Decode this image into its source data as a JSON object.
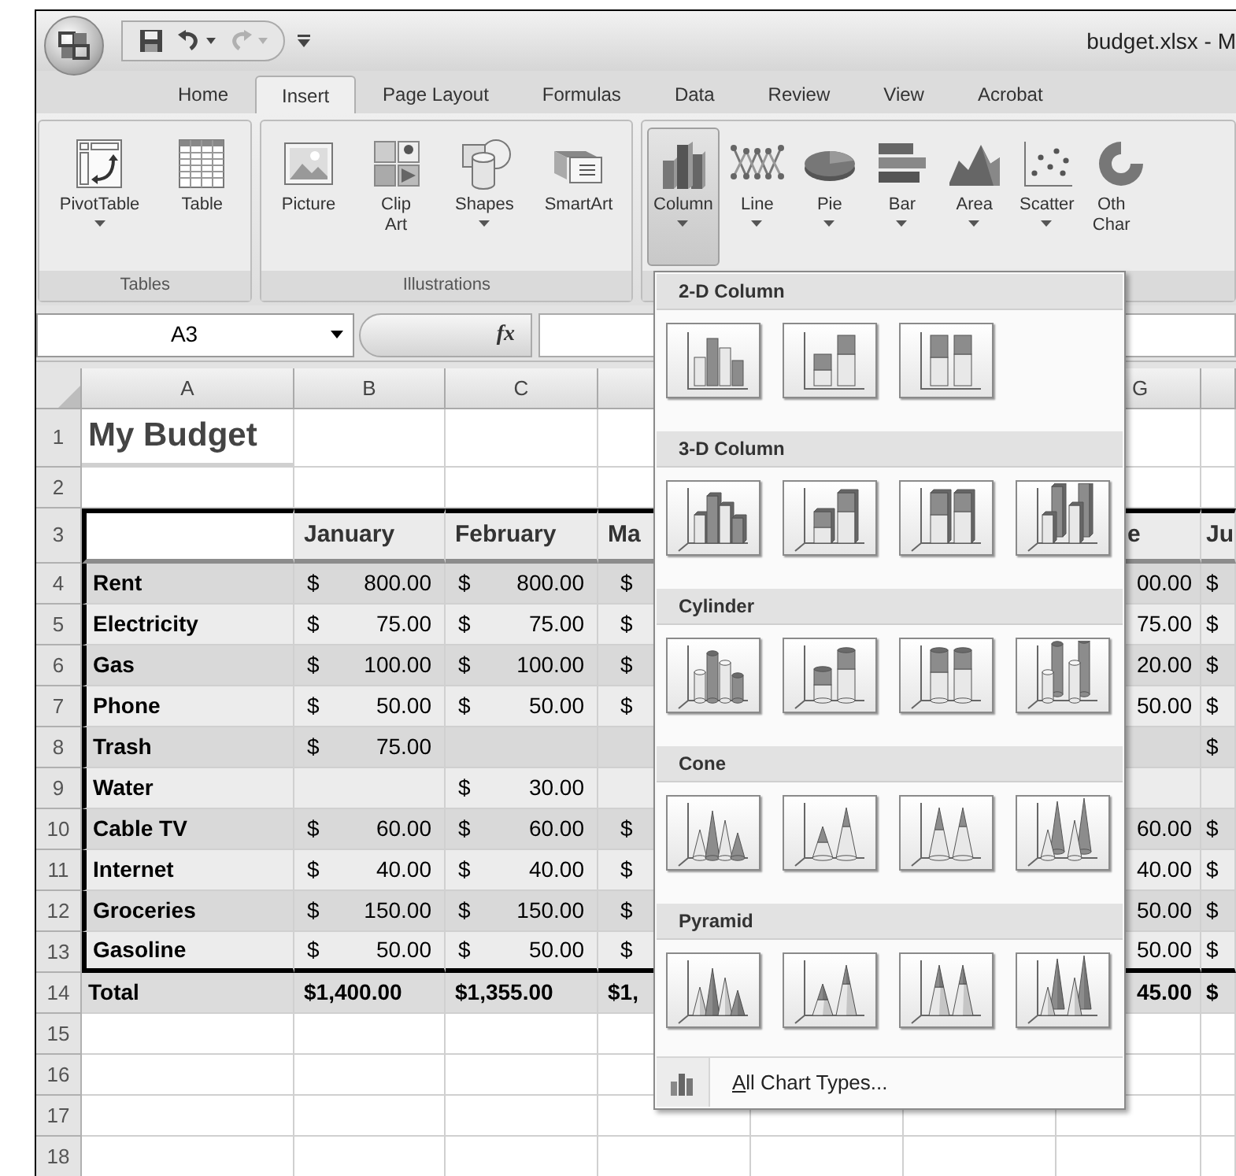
{
  "window": {
    "title": "budget.xlsx - M"
  },
  "quick_access": [
    {
      "kind": "save",
      "disabled": false
    },
    {
      "kind": "undo",
      "disabled": false
    },
    {
      "kind": "redo",
      "disabled": true
    }
  ],
  "ribbon_tabs": [
    {
      "label": "Home",
      "selected": false
    },
    {
      "label": "Insert",
      "selected": true
    },
    {
      "label": "Page Layout",
      "selected": false
    },
    {
      "label": "Formulas",
      "selected": false
    },
    {
      "label": "Data",
      "selected": false
    },
    {
      "label": "Review",
      "selected": false
    },
    {
      "label": "View",
      "selected": false
    },
    {
      "label": "Acrobat",
      "selected": false
    }
  ],
  "ribbon_groups": [
    {
      "label": "Tables",
      "buttons": [
        {
          "kind": "pivottable",
          "lines": [
            "PivotTable"
          ],
          "dropdown": true,
          "selected": false
        },
        {
          "kind": "table",
          "lines": [
            "Table"
          ],
          "dropdown": false,
          "selected": false
        }
      ]
    },
    {
      "label": "Illustrations",
      "buttons": [
        {
          "kind": "picture",
          "lines": [
            "Picture"
          ],
          "dropdown": false,
          "selected": false
        },
        {
          "kind": "clipart",
          "lines": [
            "Clip",
            "Art"
          ],
          "dropdown": false,
          "selected": false
        },
        {
          "kind": "shapes",
          "lines": [
            "Shapes"
          ],
          "dropdown": true,
          "selected": false
        },
        {
          "kind": "smartart",
          "lines": [
            "SmartArt"
          ],
          "dropdown": false,
          "selected": false
        }
      ]
    },
    {
      "buttons": [
        {
          "kind": "column",
          "lines": [
            "Column"
          ],
          "dropdown": true,
          "selected": true
        },
        {
          "kind": "line",
          "lines": [
            "Line"
          ],
          "dropdown": true,
          "selected": false
        },
        {
          "kind": "pie",
          "lines": [
            "Pie"
          ],
          "dropdown": true,
          "selected": false
        },
        {
          "kind": "bar",
          "lines": [
            "Bar"
          ],
          "dropdown": true,
          "selected": false
        },
        {
          "kind": "area",
          "lines": [
            "Area"
          ],
          "dropdown": true,
          "selected": false
        },
        {
          "kind": "scatter",
          "lines": [
            "Scatter"
          ],
          "dropdown": true,
          "selected": false
        },
        {
          "kind": "other",
          "lines": [
            "Oth",
            "Char"
          ],
          "dropdown": false,
          "selected": false
        }
      ]
    }
  ],
  "formula_bar": {
    "name_box": "A3",
    "function_symbol": "fx"
  },
  "sheet": {
    "columns": [
      {
        "letter": "A"
      },
      {
        "letter": "B"
      },
      {
        "letter": "C"
      },
      {},
      {},
      {},
      {
        "letter": "G"
      },
      {}
    ],
    "rows": [
      {
        "number": "1",
        "kind": "title",
        "cells": [
          {
            "text": "My Budget"
          },
          null,
          null,
          null,
          null,
          null,
          null,
          null
        ]
      },
      {
        "number": "2",
        "kind": "blank",
        "cells": [
          null,
          null,
          null,
          null,
          null,
          null,
          null,
          null
        ]
      },
      {
        "number": "3",
        "kind": "header",
        "cells": [
          null,
          {
            "text": "January"
          },
          {
            "text": "February"
          },
          {
            "text": "Ma"
          },
          null,
          null,
          {
            "text": "e"
          },
          {
            "text": "Ju"
          }
        ]
      },
      {
        "number": "4",
        "kind": "item",
        "cells": [
          {
            "text": "Rent"
          },
          {
            "currency": "$",
            "amount": "800.00"
          },
          {
            "currency": "$",
            "amount": "800.00"
          },
          {
            "currency": "$"
          },
          null,
          null,
          {
            "amount": "00.00"
          },
          {
            "currency": "$"
          }
        ]
      },
      {
        "number": "5",
        "kind": "item",
        "cells": [
          {
            "text": "Electricity"
          },
          {
            "currency": "$",
            "amount": "75.00"
          },
          {
            "currency": "$",
            "amount": "75.00"
          },
          {
            "currency": "$"
          },
          null,
          null,
          {
            "amount": "75.00"
          },
          {
            "currency": "$"
          }
        ]
      },
      {
        "number": "6",
        "kind": "item",
        "cells": [
          {
            "text": "Gas"
          },
          {
            "currency": "$",
            "amount": "100.00"
          },
          {
            "currency": "$",
            "amount": "100.00"
          },
          {
            "currency": "$"
          },
          null,
          null,
          {
            "amount": "20.00"
          },
          {
            "currency": "$"
          }
        ]
      },
      {
        "number": "7",
        "kind": "item",
        "cells": [
          {
            "text": "Phone"
          },
          {
            "currency": "$",
            "amount": "50.00"
          },
          {
            "currency": "$",
            "amount": "50.00"
          },
          {
            "currency": "$"
          },
          null,
          null,
          {
            "amount": "50.00"
          },
          {
            "currency": "$"
          }
        ]
      },
      {
        "number": "8",
        "kind": "item",
        "cells": [
          {
            "text": "Trash"
          },
          {
            "currency": "$",
            "amount": "75.00"
          },
          null,
          null,
          null,
          null,
          null,
          {
            "currency": "$"
          }
        ]
      },
      {
        "number": "9",
        "kind": "item",
        "cells": [
          {
            "text": "Water"
          },
          null,
          {
            "currency": "$",
            "amount": "30.00"
          },
          null,
          null,
          null,
          null,
          null
        ]
      },
      {
        "number": "10",
        "kind": "item",
        "cells": [
          {
            "text": "Cable TV"
          },
          {
            "currency": "$",
            "amount": "60.00"
          },
          {
            "currency": "$",
            "amount": "60.00"
          },
          {
            "currency": "$"
          },
          null,
          null,
          {
            "amount": "60.00"
          },
          {
            "currency": "$"
          }
        ]
      },
      {
        "number": "11",
        "kind": "item",
        "cells": [
          {
            "text": "Internet"
          },
          {
            "currency": "$",
            "amount": "40.00"
          },
          {
            "currency": "$",
            "amount": "40.00"
          },
          {
            "currency": "$"
          },
          null,
          null,
          {
            "amount": "40.00"
          },
          {
            "currency": "$"
          }
        ]
      },
      {
        "number": "12",
        "kind": "item",
        "cells": [
          {
            "text": "Groceries"
          },
          {
            "currency": "$",
            "amount": "150.00"
          },
          {
            "currency": "$",
            "amount": "150.00"
          },
          {
            "currency": "$"
          },
          null,
          null,
          {
            "amount": "50.00"
          },
          {
            "currency": "$"
          }
        ]
      },
      {
        "number": "13",
        "kind": "item",
        "cells": [
          {
            "text": "Gasoline"
          },
          {
            "currency": "$",
            "amount": "50.00"
          },
          {
            "currency": "$",
            "amount": "50.00"
          },
          {
            "currency": "$"
          },
          null,
          null,
          {
            "amount": "50.00"
          },
          {
            "currency": "$"
          }
        ]
      },
      {
        "number": "14",
        "kind": "total",
        "cells": [
          {
            "text": "Total"
          },
          {
            "text": "$1,400.00"
          },
          {
            "text": "$1,355.00"
          },
          {
            "text": "$1,"
          },
          null,
          null,
          {
            "amount": "45.00"
          },
          {
            "currency": "$"
          }
        ]
      },
      {
        "number": "15",
        "kind": "blank",
        "cells": [
          null,
          null,
          null,
          null,
          null,
          null,
          null,
          null
        ]
      },
      {
        "number": "16",
        "kind": "blank",
        "cells": [
          null,
          null,
          null,
          null,
          null,
          null,
          null,
          null
        ]
      },
      {
        "number": "17",
        "kind": "blank",
        "cells": [
          null,
          null,
          null,
          null,
          null,
          null,
          null,
          null
        ]
      },
      {
        "number": "18",
        "kind": "blank",
        "cells": [
          null,
          null,
          null,
          null,
          null,
          null,
          null,
          null
        ]
      }
    ]
  },
  "chart_menu": {
    "sections": [
      {
        "title": "2-D Column",
        "kind": "column2d",
        "options": [
          {
            "kind": "clustered"
          },
          {
            "kind": "stacked"
          },
          {
            "kind": "percent"
          }
        ]
      },
      {
        "title": "3-D Column",
        "kind": "column3d",
        "options": [
          {
            "kind": "clustered"
          },
          {
            "kind": "stacked"
          },
          {
            "kind": "percent"
          },
          {
            "kind": "depth"
          }
        ]
      },
      {
        "title": "Cylinder",
        "kind": "cylinder",
        "options": [
          {
            "kind": "clustered"
          },
          {
            "kind": "stacked"
          },
          {
            "kind": "percent"
          },
          {
            "kind": "depth"
          }
        ]
      },
      {
        "title": "Cone",
        "kind": "cone",
        "options": [
          {
            "kind": "clustered"
          },
          {
            "kind": "stacked"
          },
          {
            "kind": "percent"
          },
          {
            "kind": "depth"
          }
        ]
      },
      {
        "title": "Pyramid",
        "kind": "pyramid",
        "options": [
          {
            "kind": "clustered"
          },
          {
            "kind": "stacked"
          },
          {
            "kind": "percent"
          },
          {
            "kind": "depth"
          }
        ]
      }
    ],
    "footer_label": "All Chart Types..."
  }
}
